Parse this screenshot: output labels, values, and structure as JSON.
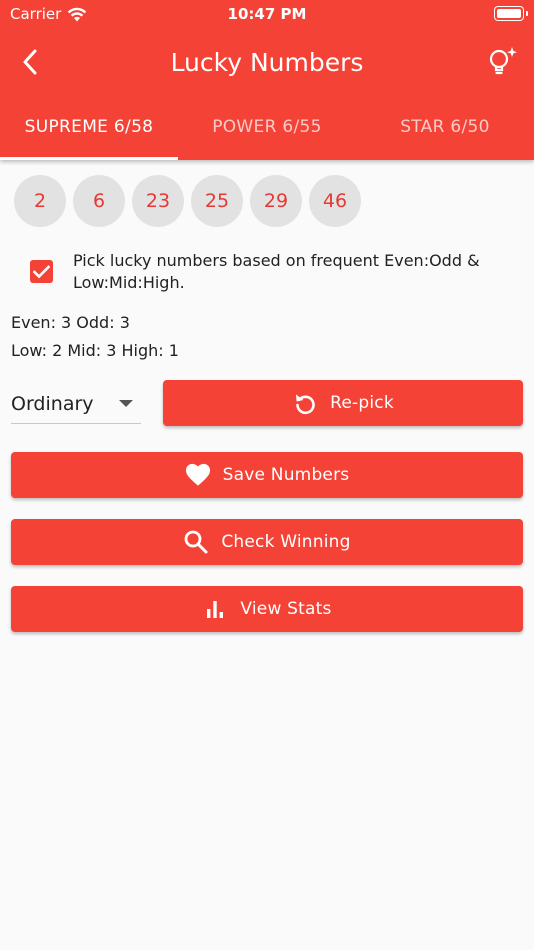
{
  "status": {
    "carrier": "Carrier",
    "time": "10:47 PM"
  },
  "toolbar": {
    "title": "Lucky Numbers",
    "back_icon": "arrow-back-icon",
    "action_icon": "lightbulb-sparkle-icon"
  },
  "tabs": [
    {
      "label": "SUPREME 6/58",
      "active": true
    },
    {
      "label": "POWER 6/55",
      "active": false
    },
    {
      "label": "STAR 6/50",
      "active": false
    }
  ],
  "numbers": [
    "2",
    "6",
    "23",
    "25",
    "29",
    "46"
  ],
  "option": {
    "checked": true,
    "label": "Pick lucky numbers based on frequent Even:Odd & Low:Mid:High."
  },
  "stats": {
    "even_odd": "Even: 3 Odd: 3",
    "low_mid_high": "Low: 2 Mid: 3 High: 1"
  },
  "dropdown": {
    "selected": "Ordinary"
  },
  "buttons": {
    "repick": "Re-pick",
    "save": "Save Numbers",
    "check": "Check Winning",
    "stats": "View Stats"
  },
  "colors": {
    "primary": "#f44336",
    "ball_bg": "#e2e2e2",
    "ball_text": "#e53935",
    "background": "#fafafa"
  }
}
